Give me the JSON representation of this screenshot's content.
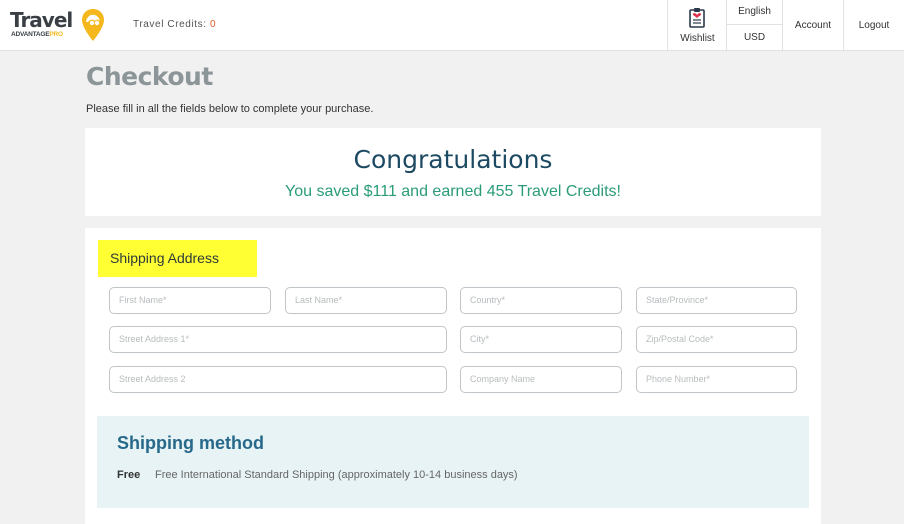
{
  "header": {
    "logo_text": "Travel",
    "logo_sub": "ADVANTAGE",
    "logo_pro": "PRO",
    "credits_label": "Travel Credits:",
    "credits_value": "0",
    "wishlist_label": "Wishlist",
    "language": "English",
    "currency": "USD",
    "account_label": "Account",
    "logout_label": "Logout"
  },
  "page": {
    "title": "Checkout",
    "subtitle": "Please fill in all the fields below to complete your purchase."
  },
  "congrats": {
    "heading": "Congratulations",
    "message": "You saved $111 and earned 455 Travel Credits!"
  },
  "shipping_address": {
    "label": "Shipping Address",
    "fields": {
      "first_name": "First Name*",
      "last_name": "Last Name*",
      "country": "Country*",
      "state": "State/Province*",
      "street1": "Street Address 1*",
      "city": "City*",
      "zip": "Zip/Postal Code*",
      "street2": "Street Address 2",
      "company": "Company Name",
      "phone": "Phone Number*"
    }
  },
  "shipping_method": {
    "title": "Shipping method",
    "price": "Free",
    "description": "Free International Standard Shipping (approximately 10-14 business days)"
  },
  "colors": {
    "accent_yellow": "#ffff33",
    "title_navy": "#1d4a63",
    "savings_green": "#2a9c7a",
    "credits_orange": "#e55a2b",
    "method_blue": "#27698a"
  }
}
